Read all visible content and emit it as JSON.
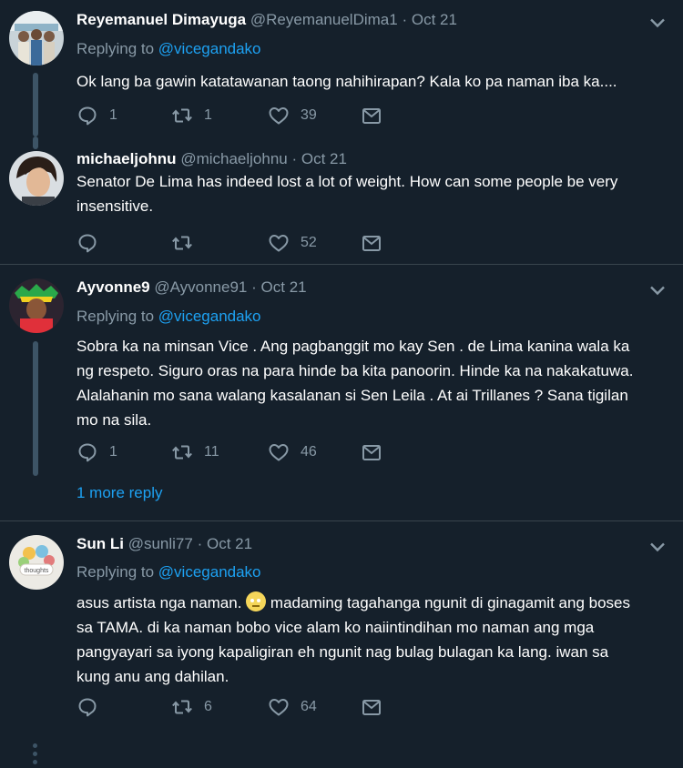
{
  "tweets": [
    {
      "name": "Reyemanuel Dimayuga",
      "handle": "@ReyemanuelDima1",
      "sep": "·",
      "date": "Oct 21",
      "replying_prefix": "Replying to",
      "replying_to": "@vicegandako",
      "text": "Ok lang ba gawin katatawanan taong nahihirapan? Kala ko pa naman iba ka....",
      "replies": "1",
      "retweets": "1",
      "likes": "39"
    },
    {
      "name": "michaeljohnu",
      "handle": "@michaeljohnu",
      "sep": "·",
      "date": "Oct 21",
      "text_lines": [
        "Senator De Lima has indeed lost a lot of weight. How can some people be very",
        "insensitive."
      ],
      "replies": "",
      "retweets": "",
      "likes": "52"
    },
    {
      "name": "Ayvonne9",
      "handle": "@Ayvonne91",
      "sep": "·",
      "date": "Oct 21",
      "replying_prefix": "Replying to",
      "replying_to": "@vicegandako",
      "text_lines": [
        "Sobra ka na minsan Vice . Ang pagbanggit mo kay Sen . de Lima kanina wala ka",
        "ng respeto. Siguro oras na para hinde ba kita panoorin. Hinde ka na nakakatuwa.",
        "Alalahanin mo sana walang kasalanan si Sen Leila . At ai Trillanes ? Sana tigilan",
        "mo na sila."
      ],
      "replies": "1",
      "retweets": "11",
      "likes": "46",
      "more_reply": "1 more reply"
    },
    {
      "name": "Sun Li",
      "handle": "@sunli77",
      "sep": "·",
      "date": "Oct 21",
      "replying_prefix": "Replying to",
      "replying_to": "@vicegandako",
      "text_first_a": "asus artista nga naman.",
      "text_first_b": "madaming tagahanga ngunit di ginagamit ang boses",
      "text_lines": [
        "sa TAMA.  di ka naman bobo vice alam ko naiintindihan mo naman ang mga",
        "pangyayari sa iyong kapaligiran eh  ngunit nag bulag bulagan ka lang.  iwan sa",
        "kung anu ang dahilan."
      ],
      "avatar_text": "thoughts",
      "replies": "",
      "retweets": "6",
      "likes": "64"
    }
  ],
  "icons": [
    "reply-icon",
    "retweet-icon",
    "like-icon",
    "message-icon",
    "chevron-down-icon"
  ],
  "colors": {
    "background": "#15202b",
    "accent": "#1da1f2",
    "muted": "#8899a6",
    "divider": "#38444d"
  }
}
